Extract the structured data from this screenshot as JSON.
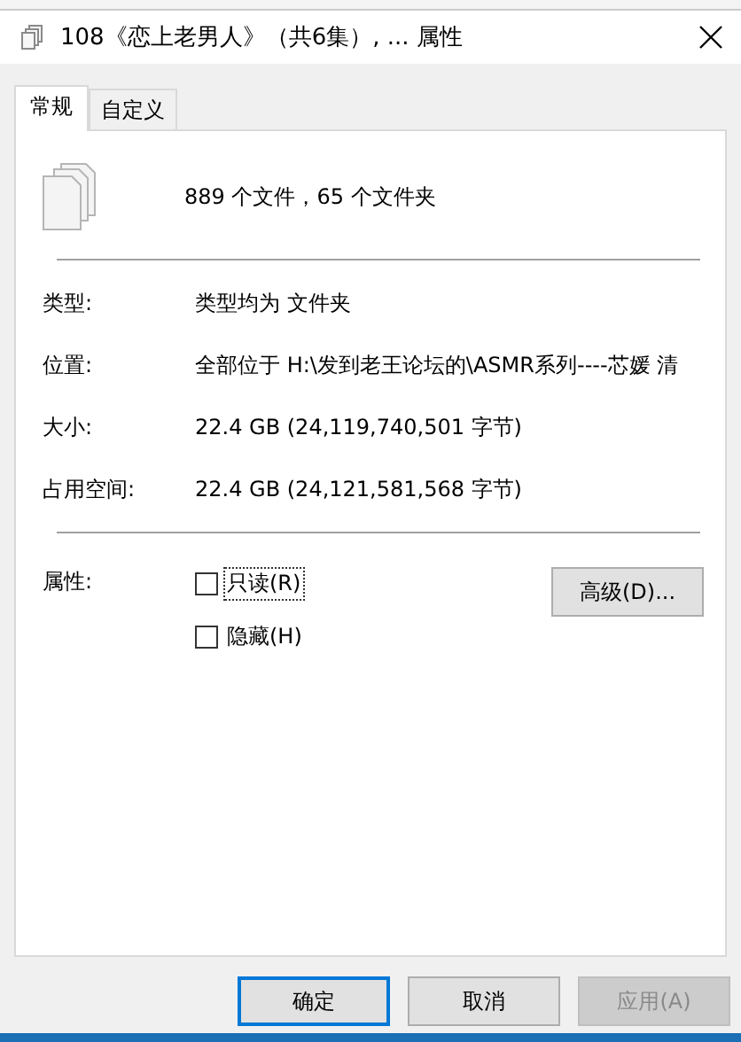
{
  "window": {
    "title": "108《恋上老男人》（共6集）, ... 属性"
  },
  "tabs": [
    {
      "label": "常规",
      "selected": true
    },
    {
      "label": "自定义",
      "selected": false
    }
  ],
  "summary": "889 个文件，65 个文件夹",
  "fields": [
    {
      "label": "类型:",
      "value": "类型均为 文件夹"
    },
    {
      "label": "位置:",
      "value": "全部位于 H:\\发到老王论坛的\\ASMR系列----芯媛 清"
    },
    {
      "label": "大小:",
      "value": "22.4 GB (24,119,740,501 字节)"
    },
    {
      "label": "占用空间:",
      "value": "22.4 GB (24,121,581,568 字节)"
    }
  ],
  "attributes": {
    "label": "属性:",
    "options": [
      {
        "label": "只读(R)",
        "checked": false,
        "focused": true
      },
      {
        "label": "隐藏(H)",
        "checked": false,
        "focused": false
      }
    ],
    "advanced_button": "高级(D)..."
  },
  "buttons": [
    {
      "label": "确定",
      "default": true,
      "disabled": false
    },
    {
      "label": "取消",
      "default": false,
      "disabled": false
    },
    {
      "label": "应用(A)",
      "default": false,
      "disabled": true
    }
  ]
}
